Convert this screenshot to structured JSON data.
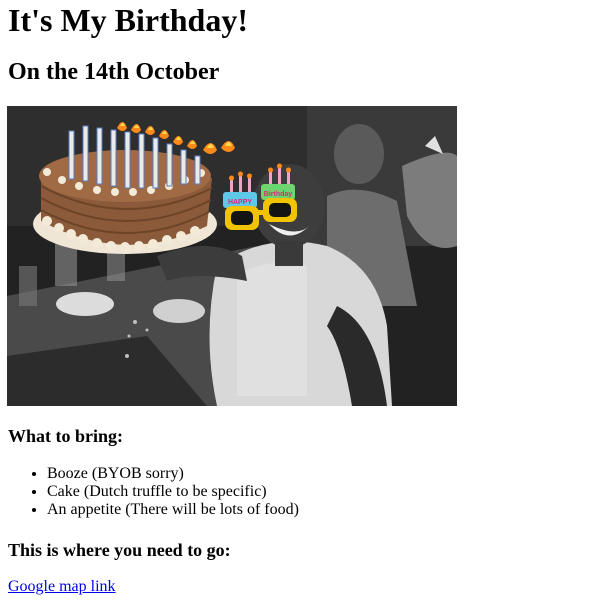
{
  "page": {
    "title": "It's My Birthday!",
    "date_heading": "On the 14th October"
  },
  "photo": {
    "subject": "black-and-white party photo with cartoon birthday cake and novelty glasses",
    "glasses_text_left": "HAPPY",
    "glasses_text_right": "Birthday"
  },
  "bring": {
    "heading": "What to bring:",
    "items": [
      "Booze (BYOB sorry)",
      "Cake (Dutch truffle to be specific)",
      "An appetite (There will be lots of food)"
    ]
  },
  "location": {
    "heading": "This is where you need to go:",
    "link_text": "Google map link"
  },
  "colors": {
    "link": "#0000ee",
    "cake_frosting": "#8a5a3a",
    "glasses_frame": "#f2c300",
    "candle_flame": "#ff8a1a"
  }
}
